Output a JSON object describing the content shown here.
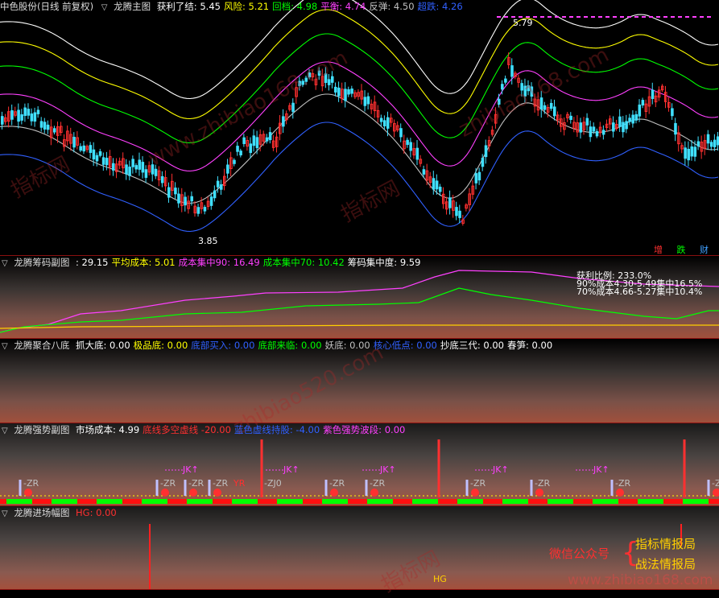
{
  "main": {
    "stock": "中色股份(日线 前复权)",
    "indicator": "龙腾主图",
    "items": [
      {
        "label": "获利了结:",
        "value": "5.45",
        "color": "#ffffff"
      },
      {
        "label": "风险:",
        "value": "5.21",
        "color": "#ffff00"
      },
      {
        "label": "回档:",
        "value": "4.98",
        "color": "#00ff00"
      },
      {
        "label": "平衡:",
        "value": "4.74",
        "color": "#ff40ff"
      },
      {
        "label": "反弹:",
        "value": "4.50",
        "color": "#c0c0c0"
      },
      {
        "label": "超跌:",
        "value": "4.26",
        "color": "#3060ff"
      }
    ],
    "high_label": "5.79",
    "low_label": "3.85",
    "corner": [
      {
        "text": "增",
        "color": "#ff3030"
      },
      {
        "text": "跌",
        "color": "#00ff00"
      },
      {
        "text": "财",
        "color": "#40a0ff"
      }
    ]
  },
  "chips": {
    "indicator": "龙腾筹码副图",
    "items": [
      {
        "label": ":",
        "value": "29.15",
        "color": "#ffffff"
      },
      {
        "label": "平均成本:",
        "value": "5.01",
        "color": "#ffff00"
      },
      {
        "label": "成本集中90:",
        "value": "16.49",
        "color": "#ff40ff"
      },
      {
        "label": "成本集中70:",
        "value": "10.42",
        "color": "#00ff00"
      },
      {
        "label": "筹码集中度:",
        "value": "9.59",
        "color": "#ffffff"
      }
    ],
    "info": [
      "获利比例: 233.0%",
      "90%成本4.30-5.49集中16.5%",
      "70%成本4.66-5.27集中10.4%"
    ]
  },
  "bottom8": {
    "indicator": "龙腾聚合八底",
    "items": [
      {
        "label": "抓大底:",
        "value": "0.00",
        "color": "#ffffff"
      },
      {
        "label": "极品底:",
        "value": "0.00",
        "color": "#ffff00"
      },
      {
        "label": "底部买入:",
        "value": "0.00",
        "color": "#3060ff"
      },
      {
        "label": "底部来临:",
        "value": "0.00",
        "color": "#00ff00"
      },
      {
        "label": "妖底:",
        "value": "0.00",
        "color": "#c0c0c0"
      },
      {
        "label": "核心低点:",
        "value": "0.00",
        "color": "#3060ff"
      },
      {
        "label": "抄底三代:",
        "value": "0.00",
        "color": "#ffffff"
      },
      {
        "label": "春笋:",
        "value": "0.00",
        "color": "#ffffff"
      }
    ]
  },
  "strong": {
    "indicator": "龙腾强势副图",
    "items": [
      {
        "label": "市场成本:",
        "value": "4.99",
        "color": "#ffffff"
      },
      {
        "label": "底线多空虚线",
        "value": "-20.00",
        "color": "#ff3030"
      },
      {
        "label": "蓝色虚线持股:",
        "value": "-4.00",
        "color": "#3060ff"
      },
      {
        "label": "紫色强势波段:",
        "value": "0.00",
        "color": "#ff40ff"
      }
    ],
    "zr_label": "ZR",
    "zj_label": "ZJ0",
    "jk_label": "JK",
    "yr_label": "YR"
  },
  "entry": {
    "indicator": "龙腾进场幅图",
    "items": [
      {
        "label": "HG:",
        "value": "0.00",
        "color": "#ff3030"
      }
    ],
    "hg_label": "HG",
    "promo_left": "微信公众号",
    "promo_right": [
      "指标情报局",
      "战法情报局"
    ],
    "website": "www.zhibiao168.com"
  },
  "watermarks": [
    "www.zhibiao168.com",
    "指标网",
    "zhibiao168.com",
    "指标网",
    "zhibiao520.com",
    "指标网"
  ]
}
